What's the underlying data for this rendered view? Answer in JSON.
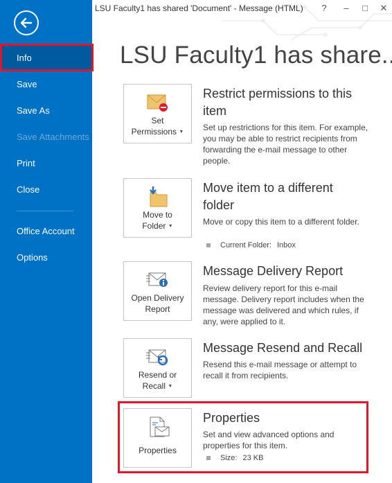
{
  "window": {
    "title": "LSU Faculty1 has shared 'Document' - Message (HTML)",
    "help_label": "?",
    "minimize_label": "–",
    "maximize_label": "□",
    "close_label": "✕"
  },
  "sidebar": {
    "items": [
      {
        "label": "Info"
      },
      {
        "label": "Save"
      },
      {
        "label": "Save As"
      },
      {
        "label": "Save Attachments"
      },
      {
        "label": "Print"
      },
      {
        "label": "Close"
      },
      {
        "label": "Office Account"
      },
      {
        "label": "Options"
      }
    ]
  },
  "main": {
    "title": "LSU Faculty1 has share...",
    "sections": [
      {
        "button_label_line1": "Set",
        "button_label_line2": "Permissions",
        "title_line1": "Restrict permissions to this",
        "title_line2": "item",
        "description": "Set up restrictions for this item. For example, you may be able to restrict recipients from forwarding the e-mail message to other people."
      },
      {
        "button_label_line1": "Move to",
        "button_label_line2": "Folder",
        "title_line1": "Move item to a different",
        "title_line2": "folder",
        "description": "Move or copy this item to a different folder.",
        "meta_label": "Current Folder:",
        "meta_value": "Inbox"
      },
      {
        "button_label_line1": "Open Delivery",
        "button_label_line2": "Report",
        "title_line1": "Message Delivery Report",
        "description": "Review delivery report for this e-mail message. Delivery report includes when the message was delivered and which rules, if any, were applied to it."
      },
      {
        "button_label_line1": "Resend or",
        "button_label_line2": "Recall",
        "title_line1": "Message Resend and Recall",
        "description": "Resend this e-mail message or attempt to recall it from recipients."
      },
      {
        "button_label_line1": "Properties",
        "title_line1": "Properties",
        "description": "Set and view advanced options and properties for this item.",
        "meta_label": "Size:",
        "meta_value": "23 KB"
      }
    ]
  },
  "colors": {
    "sidebar_bg": "#0072c6",
    "sidebar_active": "#005a9e",
    "highlight_red": "#e3152a"
  },
  "icons": [
    "back-arrow-icon",
    "help-icon",
    "minimize-icon",
    "maximize-icon",
    "close-icon",
    "envelope-restrict-icon",
    "move-folder-icon",
    "delivery-report-icon",
    "resend-recall-icon",
    "properties-icon"
  ]
}
